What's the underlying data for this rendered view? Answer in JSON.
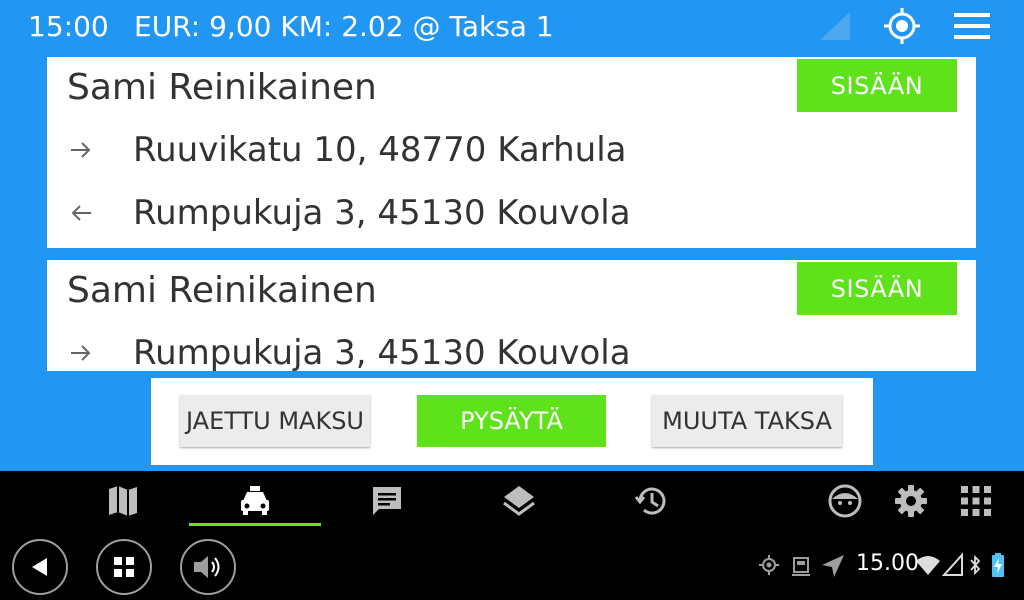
{
  "status_bar": {
    "time": "15:00",
    "fare_info": "EUR: 9,00 KM: 2.02 @ Taksa 1",
    "icons": [
      "signal-icon",
      "gps-icon",
      "menu-icon"
    ]
  },
  "rides": [
    {
      "passenger": "Sami Reinikainen",
      "button_label": "SISÄÄN",
      "pickup": "Ruuvikatu 10, 48770 Karhula",
      "dropoff": "Rumpukuja 3, 45130 Kouvola"
    },
    {
      "passenger": "Sami Reinikainen",
      "button_label": "SISÄÄN",
      "pickup": "Rumpukuja 3, 45130 Kouvola"
    }
  ],
  "actions": {
    "shared_payment": "JAETTU MAKSU",
    "stop": "PYSÄYTÄ",
    "change_fare": "MUUTA TAKSA"
  },
  "bottom_nav": {
    "items": [
      "map-icon",
      "taxi-icon",
      "chat-icon",
      "layers-icon",
      "history-icon",
      "face-icon",
      "settings-icon",
      "apps-grid-icon"
    ],
    "active": "taxi-icon"
  },
  "system_bar": {
    "time": "15.00"
  },
  "colors": {
    "app_background": "#2196f3",
    "accent_green": "#5ee31b",
    "card_background": "#ffffff",
    "nav_background": "#000000"
  }
}
